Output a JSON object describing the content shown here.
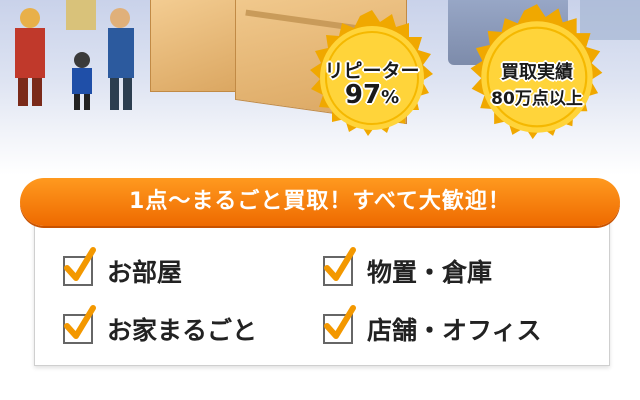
{
  "hero": {
    "badges": [
      {
        "line1": "リピーター",
        "line2": "97",
        "unit": "%"
      },
      {
        "line1": "買取実績",
        "line2": "80万点以上"
      }
    ]
  },
  "banner": {
    "text": "1点～まるごと買取！すべて大歓迎！"
  },
  "checklist": [
    {
      "label": "お部屋"
    },
    {
      "label": "物置・倉庫"
    },
    {
      "label": "お家まるごと"
    },
    {
      "label": "店舗・オフィス"
    }
  ],
  "colors": {
    "accent": "#ee6a00",
    "check": "#f39800",
    "gold": "#f5b800"
  }
}
